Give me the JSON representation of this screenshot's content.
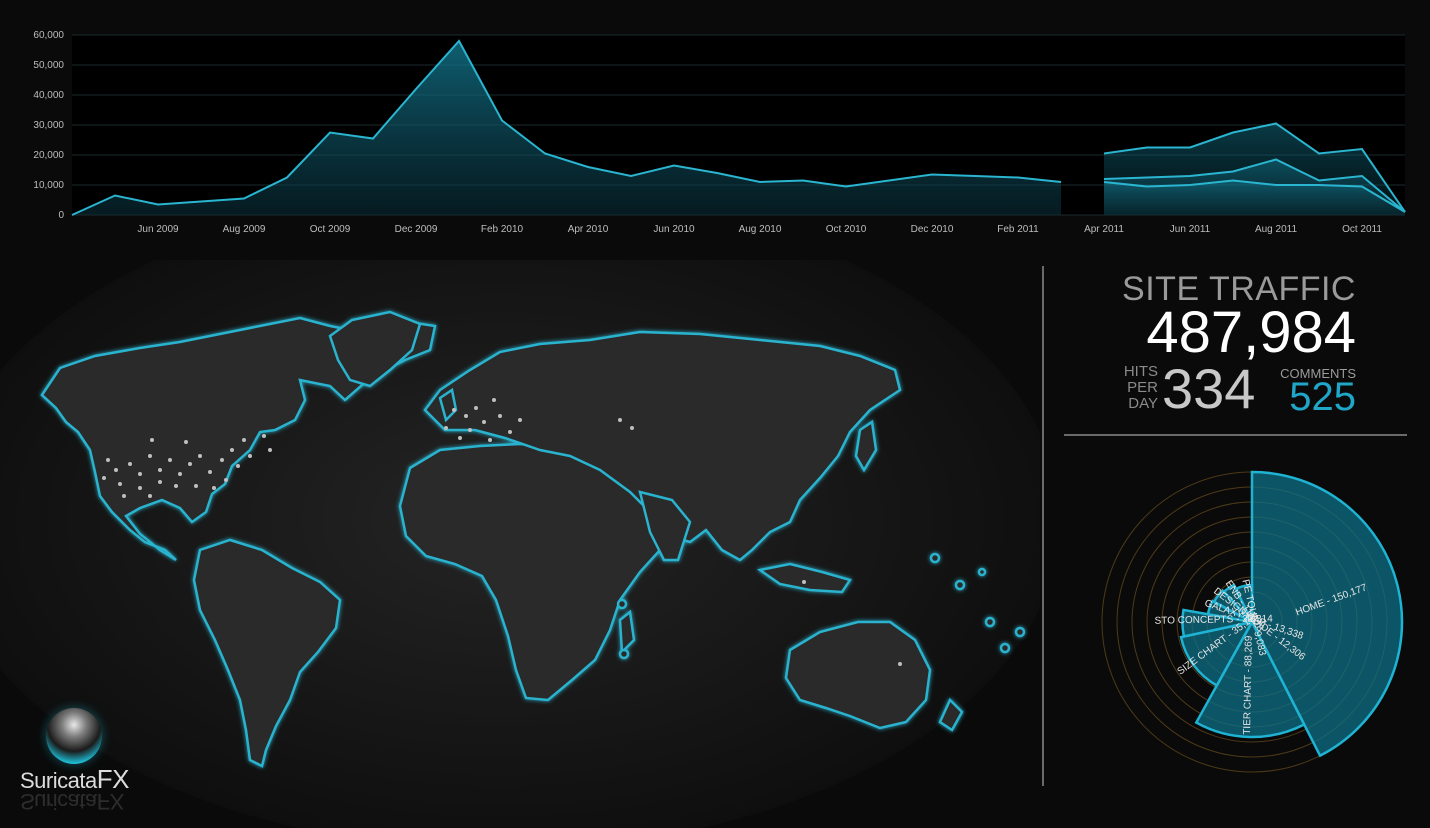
{
  "timeline": {
    "y_ticks": [
      "60,000",
      "50,000",
      "40,000",
      "30,000",
      "20,000",
      "10,000",
      "0"
    ],
    "x_ticks": [
      "Jun 2009",
      "Aug 2009",
      "Oct 2009",
      "Dec 2009",
      "Feb 2010",
      "Apr 2010",
      "Jun 2010",
      "Aug 2010",
      "Oct 2010",
      "Dec 2010",
      "Feb 2011",
      "Apr 2011",
      "Jun 2011",
      "Aug 2011",
      "Oct 2011"
    ]
  },
  "traffic": {
    "title": "SITE TRAFFIC",
    "total": "487,984",
    "hits_label_1": "HITS",
    "hits_label_2": "PER",
    "hits_label_3": "DAY",
    "hits_per_day": "334",
    "comments_label": "COMMENTS",
    "comments": "525"
  },
  "logo": {
    "name_prefix": "Suricata",
    "name_suffix": "FX",
    "icon": "orb-logo-icon"
  },
  "colors": {
    "accent": "#1fa6c8",
    "fill": "#0d6f86",
    "background": "#0a0a0a",
    "land": "#2c2c2c",
    "coast": "#2ab5d0"
  },
  "chart_data": [
    {
      "type": "area",
      "title": "",
      "xlabel": "",
      "ylabel": "",
      "ylim": [
        0,
        60000
      ],
      "grid": true,
      "x": [
        "2009-04",
        "2009-05",
        "2009-06",
        "2009-07",
        "2009-08",
        "2009-09",
        "2009-10",
        "2009-11",
        "2009-12",
        "2010-01",
        "2010-02",
        "2010-03",
        "2010-04",
        "2010-05",
        "2010-06",
        "2010-07",
        "2010-08",
        "2010-09",
        "2010-10",
        "2010-11",
        "2010-12",
        "2011-01",
        "2011-02",
        "2011-03",
        "2011-04",
        "2011-05",
        "2011-06",
        "2011-07",
        "2011-08",
        "2011-09",
        "2011-10",
        "2011-11"
      ],
      "series": [
        {
          "values": [
            0,
            6500,
            3500,
            4500,
            5500,
            12500,
            27500,
            25500,
            42000,
            58000,
            31500,
            20500,
            16000,
            13000,
            16500,
            14000,
            11000,
            11500,
            9500,
            11500,
            13500,
            13000,
            12500,
            11000,
            null,
            null,
            null,
            null,
            null,
            null,
            null,
            null
          ]
        },
        {
          "values": [
            null,
            null,
            null,
            null,
            null,
            null,
            null,
            null,
            null,
            null,
            null,
            null,
            null,
            null,
            null,
            null,
            null,
            null,
            null,
            null,
            null,
            null,
            null,
            null,
            20500,
            22500,
            22500,
            27500,
            30500,
            20500,
            22000,
            1000
          ]
        },
        {
          "values": [
            null,
            null,
            null,
            null,
            null,
            null,
            null,
            null,
            null,
            null,
            null,
            null,
            null,
            null,
            null,
            null,
            null,
            null,
            null,
            null,
            null,
            null,
            null,
            null,
            12000,
            12500,
            13000,
            14500,
            18500,
            11500,
            13000,
            1000
          ]
        },
        {
          "values": [
            null,
            null,
            null,
            null,
            null,
            null,
            null,
            null,
            null,
            null,
            null,
            null,
            null,
            null,
            null,
            null,
            null,
            null,
            null,
            null,
            null,
            null,
            null,
            null,
            11000,
            9500,
            10000,
            11500,
            10000,
            10000,
            9500,
            1000
          ]
        }
      ]
    },
    {
      "type": "pie",
      "title": "",
      "slices": [
        {
          "label": "HOME - 150,177",
          "value": 150177
        },
        {
          "label": "TIER CHART - 88,269",
          "value": 88269
        },
        {
          "label": "SIZE CHART - 35,174",
          "value": 35174
        },
        {
          "label": "STO CONCEPTS - 32,314",
          "value": 32314
        },
        {
          "label": "GALAXY MAP - 13,338",
          "value": 13338
        },
        {
          "label": "DESIGN GUIDE - 12,306",
          "value": 12306
        },
        {
          "label": "ENB - 11,328",
          "value": 11328
        },
        {
          "label": "PE TOUR - 9,083",
          "value": 9083
        }
      ]
    }
  ]
}
